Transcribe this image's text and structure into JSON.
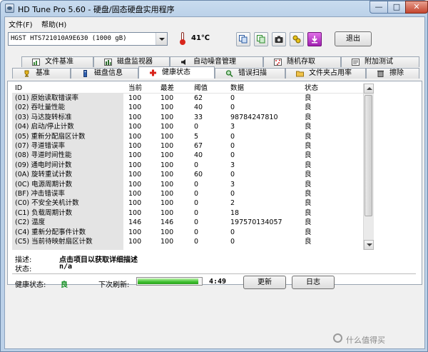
{
  "window": {
    "title": "HD Tune Pro 5.60 - 硬盘/固态硬盘实用程序"
  },
  "menu": {
    "items": [
      "文件(F)",
      "帮助(H)"
    ]
  },
  "toolbar": {
    "drive": "HGST HTS721010A9E630 (1000 gB)",
    "temperature": "41℃",
    "exit_label": "退出",
    "icons": [
      "copy-info-icon",
      "copy-all-icon",
      "screenshot-icon",
      "options-icon",
      "save-icon"
    ]
  },
  "tabs": {
    "row1": [
      "文件基准",
      "磁盘监视器",
      "自动噪音管理",
      "随机存取",
      "附加测试"
    ],
    "row2": [
      "基准",
      "磁盘信息",
      "健康状态",
      "错误扫描",
      "文件夹占用率",
      "擦除"
    ],
    "active": "健康状态"
  },
  "table": {
    "headers": [
      "ID",
      "当前",
      "最差",
      "阈值",
      "数据",
      "状态"
    ],
    "rows": [
      [
        "(01) 原始读取错误率",
        "100",
        "100",
        "62",
        "0",
        "良"
      ],
      [
        "(02) 吞吐量性能",
        "100",
        "100",
        "40",
        "0",
        "良"
      ],
      [
        "(03) 马达旋转标准",
        "100",
        "100",
        "33",
        "98784247810",
        "良"
      ],
      [
        "(04) 启动/停止计数",
        "100",
        "100",
        "0",
        "3",
        "良"
      ],
      [
        "(05) 重新分配扇区计数",
        "100",
        "100",
        "5",
        "0",
        "良"
      ],
      [
        "(07) 寻道错误率",
        "100",
        "100",
        "67",
        "0",
        "良"
      ],
      [
        "(08) 寻道时间性能",
        "100",
        "100",
        "40",
        "0",
        "良"
      ],
      [
        "(09) 通电时间计数",
        "100",
        "100",
        "0",
        "3",
        "良"
      ],
      [
        "(0A) 旋转重试计数",
        "100",
        "100",
        "60",
        "0",
        "良"
      ],
      [
        "(0C) 电源周期计数",
        "100",
        "100",
        "0",
        "3",
        "良"
      ],
      [
        "(BF) 冲击错误率",
        "100",
        "100",
        "0",
        "0",
        "良"
      ],
      [
        "(C0) 不安全关机计数",
        "100",
        "100",
        "0",
        "2",
        "良"
      ],
      [
        "(C1) 负载周期计数",
        "100",
        "100",
        "0",
        "18",
        "良"
      ],
      [
        "(C2) 温度",
        "146",
        "146",
        "0",
        "197570134057",
        "良"
      ],
      [
        "(C4) 重新分配事件计数",
        "100",
        "100",
        "0",
        "0",
        "良"
      ],
      [
        "(C5) 当前待映射扇区计数",
        "100",
        "100",
        "0",
        "0",
        "良"
      ]
    ]
  },
  "details": {
    "desc_label": "描述:",
    "desc_value": "点击项目以获取详细描述",
    "status_label": "状态:",
    "status_value": "n/a"
  },
  "footer": {
    "health_label": "健康状态:",
    "health_value": "良",
    "next_refresh_label": "下次刷新:",
    "progress_fraction": 0.95,
    "countdown": "4:49",
    "refresh_button": "更新",
    "log_button": "日志"
  },
  "watermark": "什么值得买",
  "colors": {
    "health_ok": "#0a8a1a",
    "progress": "#3cbf2e",
    "close": "#c4452e"
  }
}
